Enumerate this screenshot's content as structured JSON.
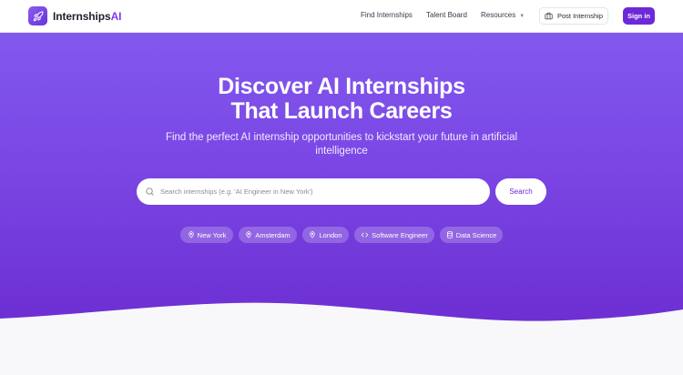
{
  "brand": {
    "name_primary": "Internships",
    "name_accent": "AI",
    "accent_color": "#7c3aed"
  },
  "nav": {
    "links": [
      {
        "label": "Find Internships"
      },
      {
        "label": "Talent Board"
      },
      {
        "label": "Resources"
      }
    ],
    "post_label": "Post Internship",
    "signin_label": "Sign in"
  },
  "hero": {
    "title_line1": "Discover AI Internships",
    "title_line2": "That Launch Careers",
    "subtitle": "Find the perfect AI internship opportunities to kickstart your future in artificial intelligence",
    "search": {
      "placeholder": "Search internships (e.g. 'AI Engineer in New York')",
      "value": "",
      "button_label": "Search"
    },
    "chips": [
      {
        "label": "New York",
        "icon": "map-pin-icon"
      },
      {
        "label": "Amsterdam",
        "icon": "map-pin-icon"
      },
      {
        "label": "London",
        "icon": "map-pin-icon"
      },
      {
        "label": "Software Engineer",
        "icon": "code-icon"
      },
      {
        "label": "Data Science",
        "icon": "database-icon"
      }
    ]
  },
  "colors": {
    "hero_top": "#8258ee",
    "hero_bottom": "#6c2dd1",
    "primary": "#6d28d9"
  }
}
